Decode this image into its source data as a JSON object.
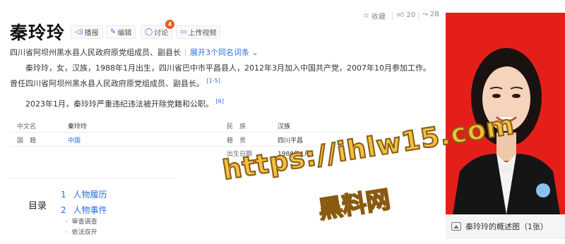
{
  "header": {
    "title": "秦玲玲",
    "buttons": [
      {
        "label": "播报",
        "icon": "speaker-icon"
      },
      {
        "label": "编辑",
        "icon": "pencil-icon"
      },
      {
        "label": "讨论",
        "icon": "chat-bubble-icon",
        "badge": "4"
      },
      {
        "label": "上传视频",
        "icon": "video-camera-icon"
      }
    ],
    "stats": {
      "collect_label": "收藏",
      "like_count": "20",
      "share_count": "28"
    }
  },
  "subtitle": {
    "text": "四川省阿坝州黑水县人民政府原党组成员、副县长",
    "expand_link": "展开3个同名词条"
  },
  "intro": {
    "paragraph1": "秦玲玲，女，汉族，1988年1月出生，四川省巴中市平昌县人，2012年3月加入中国共产党，2007年10月参加工作。曾任四川省阿坝州黑水县人民政府原党组成员、副县长。",
    "ref1": "[1-5]",
    "paragraph2": "2023年1月，秦玲玲严重违纪违法被开除党籍和公职。",
    "ref2": "[6]"
  },
  "infobox": {
    "left": [
      {
        "label": "中文名",
        "value": "秦玲玲"
      },
      {
        "label": "国　籍",
        "value": "中国"
      }
    ],
    "right": [
      {
        "label": "民　族",
        "value": "汉族"
      },
      {
        "label": "籍　贯",
        "value": "四川平昌"
      },
      {
        "label": "出生日期",
        "value": "1988年1月"
      }
    ]
  },
  "toc": {
    "title": "目录",
    "items": [
      {
        "num": "1",
        "label": "人物履历"
      },
      {
        "num": "2",
        "label": "人物事件"
      }
    ],
    "subitems": [
      "审查调查",
      "依法双开"
    ]
  },
  "photo": {
    "caption": "秦玲玲的概述图（1张）"
  },
  "watermark": {
    "line1": "https://ihlw15.com",
    "line2": "黑料网"
  },
  "colors": {
    "link": "#2e6ee6",
    "badge": "#ee5a24",
    "photo_bg": "#e41f1a",
    "watermark": "#f0c040"
  }
}
